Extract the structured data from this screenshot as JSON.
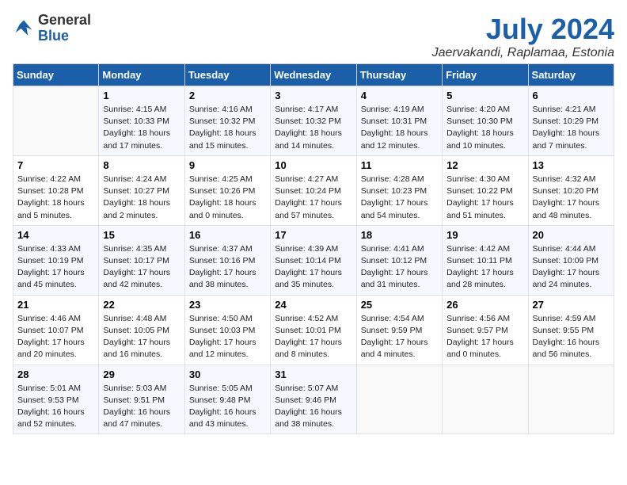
{
  "logo": {
    "general": "General",
    "blue": "Blue"
  },
  "title": "July 2024",
  "subtitle": "Jaervakandi, Raplamaa, Estonia",
  "days_header": [
    "Sunday",
    "Monday",
    "Tuesday",
    "Wednesday",
    "Thursday",
    "Friday",
    "Saturday"
  ],
  "weeks": [
    [
      {
        "day": "",
        "info": ""
      },
      {
        "day": "1",
        "info": "Sunrise: 4:15 AM\nSunset: 10:33 PM\nDaylight: 18 hours\nand 17 minutes."
      },
      {
        "day": "2",
        "info": "Sunrise: 4:16 AM\nSunset: 10:32 PM\nDaylight: 18 hours\nand 15 minutes."
      },
      {
        "day": "3",
        "info": "Sunrise: 4:17 AM\nSunset: 10:32 PM\nDaylight: 18 hours\nand 14 minutes."
      },
      {
        "day": "4",
        "info": "Sunrise: 4:19 AM\nSunset: 10:31 PM\nDaylight: 18 hours\nand 12 minutes."
      },
      {
        "day": "5",
        "info": "Sunrise: 4:20 AM\nSunset: 10:30 PM\nDaylight: 18 hours\nand 10 minutes."
      },
      {
        "day": "6",
        "info": "Sunrise: 4:21 AM\nSunset: 10:29 PM\nDaylight: 18 hours\nand 7 minutes."
      }
    ],
    [
      {
        "day": "7",
        "info": "Sunrise: 4:22 AM\nSunset: 10:28 PM\nDaylight: 18 hours\nand 5 minutes."
      },
      {
        "day": "8",
        "info": "Sunrise: 4:24 AM\nSunset: 10:27 PM\nDaylight: 18 hours\nand 2 minutes."
      },
      {
        "day": "9",
        "info": "Sunrise: 4:25 AM\nSunset: 10:26 PM\nDaylight: 18 hours\nand 0 minutes."
      },
      {
        "day": "10",
        "info": "Sunrise: 4:27 AM\nSunset: 10:24 PM\nDaylight: 17 hours\nand 57 minutes."
      },
      {
        "day": "11",
        "info": "Sunrise: 4:28 AM\nSunset: 10:23 PM\nDaylight: 17 hours\nand 54 minutes."
      },
      {
        "day": "12",
        "info": "Sunrise: 4:30 AM\nSunset: 10:22 PM\nDaylight: 17 hours\nand 51 minutes."
      },
      {
        "day": "13",
        "info": "Sunrise: 4:32 AM\nSunset: 10:20 PM\nDaylight: 17 hours\nand 48 minutes."
      }
    ],
    [
      {
        "day": "14",
        "info": "Sunrise: 4:33 AM\nSunset: 10:19 PM\nDaylight: 17 hours\nand 45 minutes."
      },
      {
        "day": "15",
        "info": "Sunrise: 4:35 AM\nSunset: 10:17 PM\nDaylight: 17 hours\nand 42 minutes."
      },
      {
        "day": "16",
        "info": "Sunrise: 4:37 AM\nSunset: 10:16 PM\nDaylight: 17 hours\nand 38 minutes."
      },
      {
        "day": "17",
        "info": "Sunrise: 4:39 AM\nSunset: 10:14 PM\nDaylight: 17 hours\nand 35 minutes."
      },
      {
        "day": "18",
        "info": "Sunrise: 4:41 AM\nSunset: 10:12 PM\nDaylight: 17 hours\nand 31 minutes."
      },
      {
        "day": "19",
        "info": "Sunrise: 4:42 AM\nSunset: 10:11 PM\nDaylight: 17 hours\nand 28 minutes."
      },
      {
        "day": "20",
        "info": "Sunrise: 4:44 AM\nSunset: 10:09 PM\nDaylight: 17 hours\nand 24 minutes."
      }
    ],
    [
      {
        "day": "21",
        "info": "Sunrise: 4:46 AM\nSunset: 10:07 PM\nDaylight: 17 hours\nand 20 minutes."
      },
      {
        "day": "22",
        "info": "Sunrise: 4:48 AM\nSunset: 10:05 PM\nDaylight: 17 hours\nand 16 minutes."
      },
      {
        "day": "23",
        "info": "Sunrise: 4:50 AM\nSunset: 10:03 PM\nDaylight: 17 hours\nand 12 minutes."
      },
      {
        "day": "24",
        "info": "Sunrise: 4:52 AM\nSunset: 10:01 PM\nDaylight: 17 hours\nand 8 minutes."
      },
      {
        "day": "25",
        "info": "Sunrise: 4:54 AM\nSunset: 9:59 PM\nDaylight: 17 hours\nand 4 minutes."
      },
      {
        "day": "26",
        "info": "Sunrise: 4:56 AM\nSunset: 9:57 PM\nDaylight: 17 hours\nand 0 minutes."
      },
      {
        "day": "27",
        "info": "Sunrise: 4:59 AM\nSunset: 9:55 PM\nDaylight: 16 hours\nand 56 minutes."
      }
    ],
    [
      {
        "day": "28",
        "info": "Sunrise: 5:01 AM\nSunset: 9:53 PM\nDaylight: 16 hours\nand 52 minutes."
      },
      {
        "day": "29",
        "info": "Sunrise: 5:03 AM\nSunset: 9:51 PM\nDaylight: 16 hours\nand 47 minutes."
      },
      {
        "day": "30",
        "info": "Sunrise: 5:05 AM\nSunset: 9:48 PM\nDaylight: 16 hours\nand 43 minutes."
      },
      {
        "day": "31",
        "info": "Sunrise: 5:07 AM\nSunset: 9:46 PM\nDaylight: 16 hours\nand 38 minutes."
      },
      {
        "day": "",
        "info": ""
      },
      {
        "day": "",
        "info": ""
      },
      {
        "day": "",
        "info": ""
      }
    ]
  ]
}
